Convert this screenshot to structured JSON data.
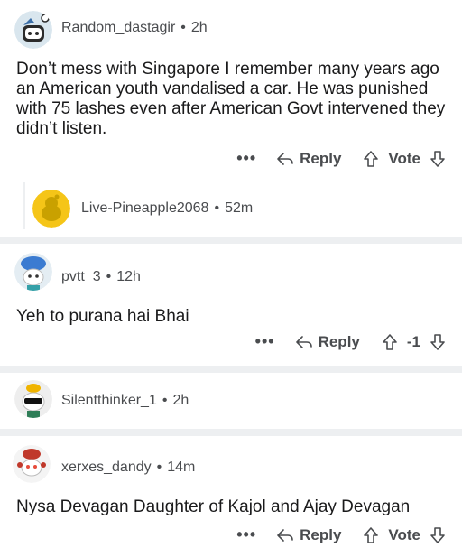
{
  "comments": [
    {
      "username": "Random_dastagir",
      "time": "2h",
      "body": "Don’t mess with Singapore I remember many years ago an American youth vandalised a car. He was punished with 75 lashes even after American Govt intervened they didn’t listen.",
      "reply_label": "Reply",
      "vote_label": "Vote"
    },
    {
      "username": "Live-Pineapple2068",
      "time": "52m"
    },
    {
      "username": "pvtt_3",
      "time": "12h",
      "body": "Yeh to purana hai Bhai",
      "reply_label": "Reply",
      "vote_label": "-1"
    },
    {
      "username": "Silentthinker_1",
      "time": "2h"
    },
    {
      "username": "xerxes_dandy",
      "time": "14m",
      "body": "Nysa Devagan Daughter of Kajol and Ajay Devagan",
      "reply_label": "Reply",
      "vote_label": "Vote"
    }
  ],
  "more_label": "•••",
  "separator": "•"
}
